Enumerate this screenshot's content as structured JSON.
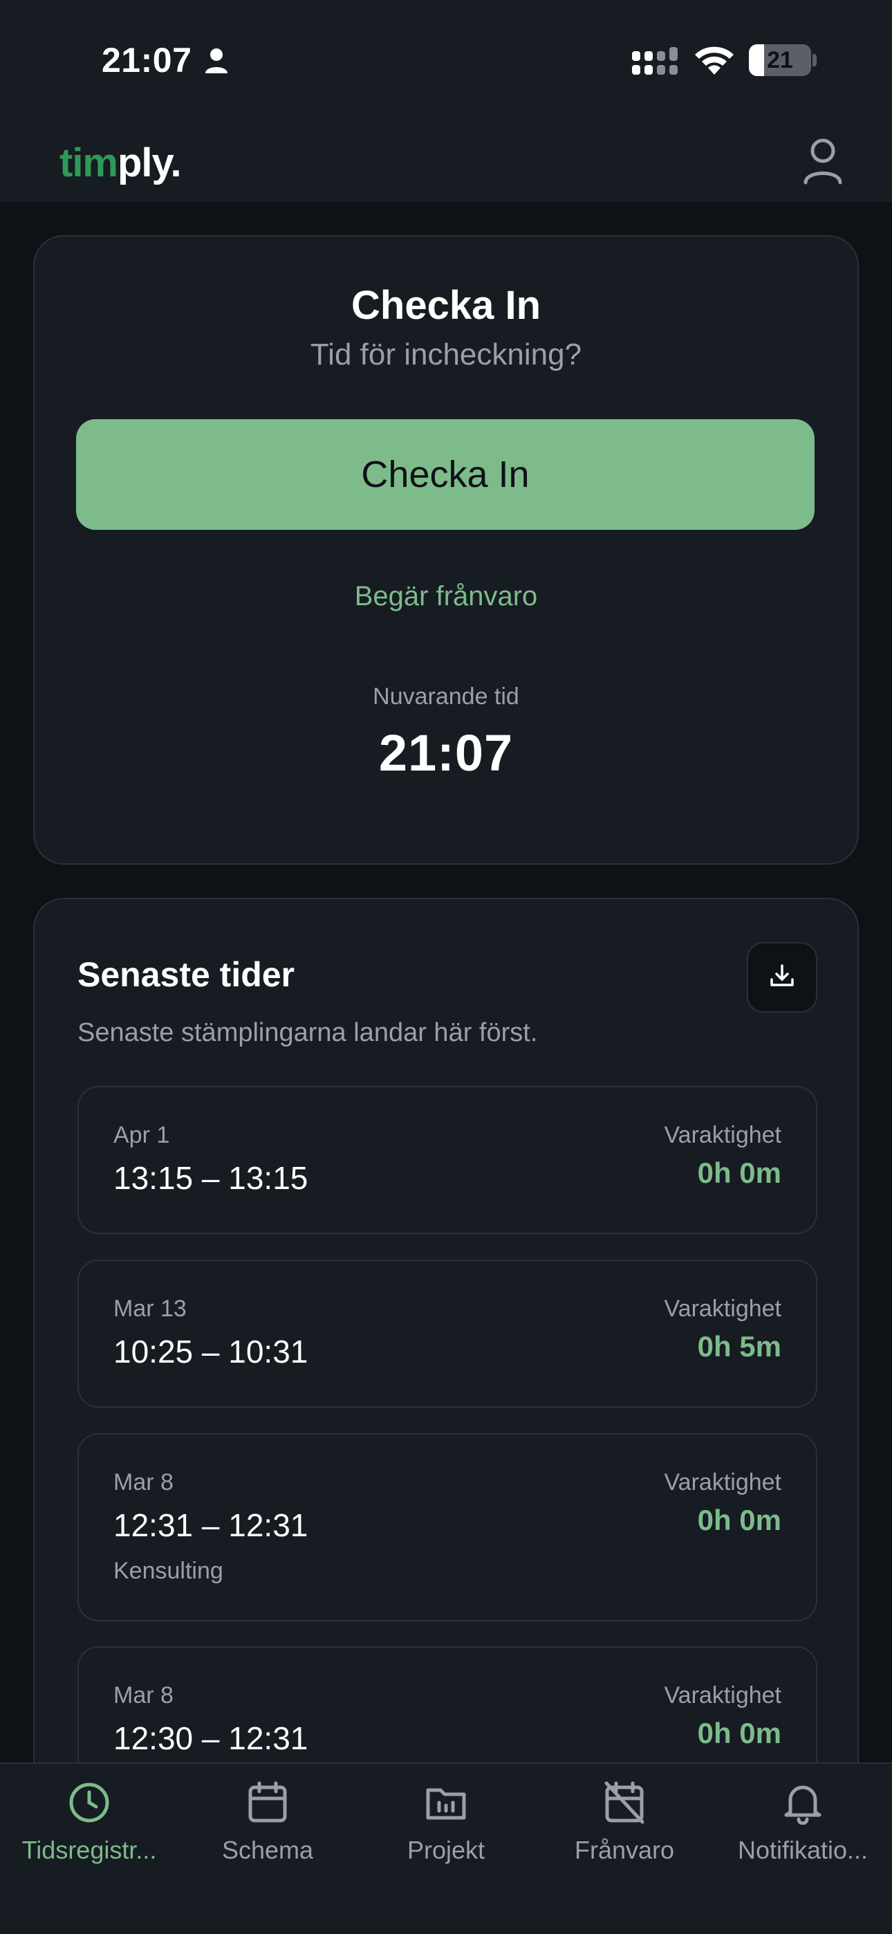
{
  "status_bar": {
    "time": "21:07",
    "battery": "21",
    "icons": [
      "person-icon",
      "signal-icon",
      "wifi-icon",
      "battery-icon"
    ]
  },
  "header": {
    "logo_part1": "tim",
    "logo_part2": "ply.",
    "profile_icon": "user-icon"
  },
  "checkin": {
    "title": "Checka In",
    "subtitle": "Tid för incheckning?",
    "button_label": "Checka In",
    "absence_link": "Begär frånvaro",
    "current_time_label": "Nuvarande tid",
    "current_time": "21:07"
  },
  "recent": {
    "title": "Senaste tider",
    "subtitle": "Senaste stämplingarna landar här först.",
    "download_icon": "download-icon",
    "entries": [
      {
        "date": "Apr 1",
        "range": "13:15 – 13:15",
        "duration_label": "Varaktighet",
        "duration": "0h 0m",
        "project": ""
      },
      {
        "date": "Mar 13",
        "range": "10:25 – 10:31",
        "duration_label": "Varaktighet",
        "duration": "0h 5m",
        "project": ""
      },
      {
        "date": "Mar 8",
        "range": "12:31 – 12:31",
        "duration_label": "Varaktighet",
        "duration": "0h 0m",
        "project": "Kensulting"
      },
      {
        "date": "Mar 8",
        "range": "12:30 – 12:31",
        "duration_label": "Varaktighet",
        "duration": "0h 0m",
        "project": ""
      }
    ]
  },
  "nav": {
    "items": [
      {
        "label": "Tidsregistr...",
        "icon": "clock-icon",
        "active": true
      },
      {
        "label": "Schema",
        "icon": "calendar-icon",
        "active": false
      },
      {
        "label": "Projekt",
        "icon": "folder-icon",
        "active": false
      },
      {
        "label": "Frånvaro",
        "icon": "calendar-off-icon",
        "active": false
      },
      {
        "label": "Notifikatio...",
        "icon": "bell-icon",
        "active": false
      }
    ]
  },
  "colors": {
    "accent": "#7dbb8b",
    "logo_green": "#2e9a55",
    "background": "#0e1116",
    "card": "#171b22",
    "muted_text": "#9aa0a8"
  }
}
